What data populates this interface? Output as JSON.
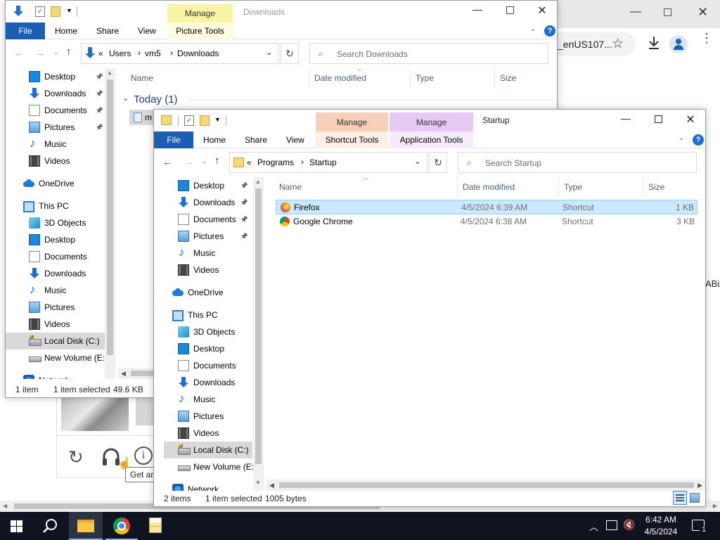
{
  "browser": {
    "url_fragment": "_enUS107...",
    "side_text": "ABiA"
  },
  "captcha": {
    "tooltip": "Get an audio challenge"
  },
  "win1": {
    "title": "Downloads",
    "manage_label": "Manage",
    "tabs": [
      "File",
      "Home",
      "Share",
      "View",
      "Picture Tools"
    ],
    "address": [
      "Users",
      "vm5",
      "Downloads"
    ],
    "search_placeholder": "Search Downloads",
    "columns": [
      "Name",
      "Date modified",
      "Type",
      "Size"
    ],
    "group_label": "Today (1)",
    "file_stub": "m",
    "nav": [
      {
        "label": "Desktop",
        "icon": "desktop-icon",
        "pinned": true
      },
      {
        "label": "Downloads",
        "icon": "downloads-icon",
        "pinned": true
      },
      {
        "label": "Documents",
        "icon": "documents-icon",
        "pinned": true
      },
      {
        "label": "Pictures",
        "icon": "pictures-icon",
        "pinned": true
      },
      {
        "label": "Music",
        "icon": "music-icon",
        "pinned": false
      },
      {
        "label": "Videos",
        "icon": "videos-icon",
        "pinned": false
      },
      {
        "label": "OneDrive",
        "icon": "onedrive-icon",
        "pinned": false
      },
      {
        "label": "This PC",
        "icon": "this-pc-icon",
        "pinned": false
      },
      {
        "label": "3D Objects",
        "icon": "3d-objects-icon",
        "pinned": false
      },
      {
        "label": "Desktop",
        "icon": "desktop-icon",
        "pinned": false
      },
      {
        "label": "Documents",
        "icon": "documents-icon",
        "pinned": false
      },
      {
        "label": "Downloads",
        "icon": "downloads-icon",
        "pinned": false
      },
      {
        "label": "Music",
        "icon": "music-icon",
        "pinned": false
      },
      {
        "label": "Pictures",
        "icon": "pictures-icon",
        "pinned": false
      },
      {
        "label": "Videos",
        "icon": "videos-icon",
        "pinned": false
      },
      {
        "label": "Local Disk (C:)",
        "icon": "local-disk-icon",
        "pinned": false,
        "selected": true
      },
      {
        "label": "New Volume (E:)",
        "icon": "volume-icon",
        "pinned": false
      },
      {
        "label": "Network",
        "icon": "network-icon",
        "pinned": false
      }
    ],
    "status": {
      "count": "1 item",
      "selected": "1 item selected",
      "size": "49.6 KB"
    }
  },
  "win2": {
    "title": "Startup",
    "manage1": "Manage",
    "manage2": "Manage",
    "tabs": [
      "File",
      "Home",
      "Share",
      "View",
      "Shortcut Tools",
      "Application Tools"
    ],
    "address": [
      "Programs",
      "Startup"
    ],
    "search_placeholder": "Search Startup",
    "columns": [
      "Name",
      "Date modified",
      "Type",
      "Size"
    ],
    "nav": [
      {
        "label": "Desktop",
        "icon": "desktop-icon",
        "pinned": true
      },
      {
        "label": "Downloads",
        "icon": "downloads-icon",
        "pinned": true
      },
      {
        "label": "Documents",
        "icon": "documents-icon",
        "pinned": true
      },
      {
        "label": "Pictures",
        "icon": "pictures-icon",
        "pinned": true
      },
      {
        "label": "Music",
        "icon": "music-icon",
        "pinned": false
      },
      {
        "label": "Videos",
        "icon": "videos-icon",
        "pinned": false
      },
      {
        "label": "OneDrive",
        "icon": "onedrive-icon",
        "pinned": false
      },
      {
        "label": "This PC",
        "icon": "this-pc-icon",
        "pinned": false
      },
      {
        "label": "3D Objects",
        "icon": "3d-objects-icon",
        "pinned": false
      },
      {
        "label": "Desktop",
        "icon": "desktop-icon",
        "pinned": false
      },
      {
        "label": "Documents",
        "icon": "documents-icon",
        "pinned": false
      },
      {
        "label": "Downloads",
        "icon": "downloads-icon",
        "pinned": false
      },
      {
        "label": "Music",
        "icon": "music-icon",
        "pinned": false
      },
      {
        "label": "Pictures",
        "icon": "pictures-icon",
        "pinned": false
      },
      {
        "label": "Videos",
        "icon": "videos-icon",
        "pinned": false
      },
      {
        "label": "Local Disk (C:)",
        "icon": "local-disk-icon",
        "pinned": false,
        "selected": true
      },
      {
        "label": "New Volume (E:)",
        "icon": "volume-icon",
        "pinned": false
      },
      {
        "label": "Network",
        "icon": "network-icon",
        "pinned": false
      }
    ],
    "files": [
      {
        "name": "Firefox",
        "date": "4/5/2024 6:39 AM",
        "type": "Shortcut",
        "size": "1 KB",
        "icon": "firefox-icon",
        "selected": true
      },
      {
        "name": "Google Chrome",
        "date": "4/5/2024 6:38 AM",
        "type": "Shortcut",
        "size": "3 KB",
        "icon": "chrome-icon",
        "selected": false
      }
    ],
    "status": {
      "count": "2 items",
      "selected": "1 item selected",
      "size": "1005 bytes"
    }
  },
  "taskbar": {
    "time": "6:42 AM",
    "date": "4/5/2024",
    "notification_count": "1"
  }
}
